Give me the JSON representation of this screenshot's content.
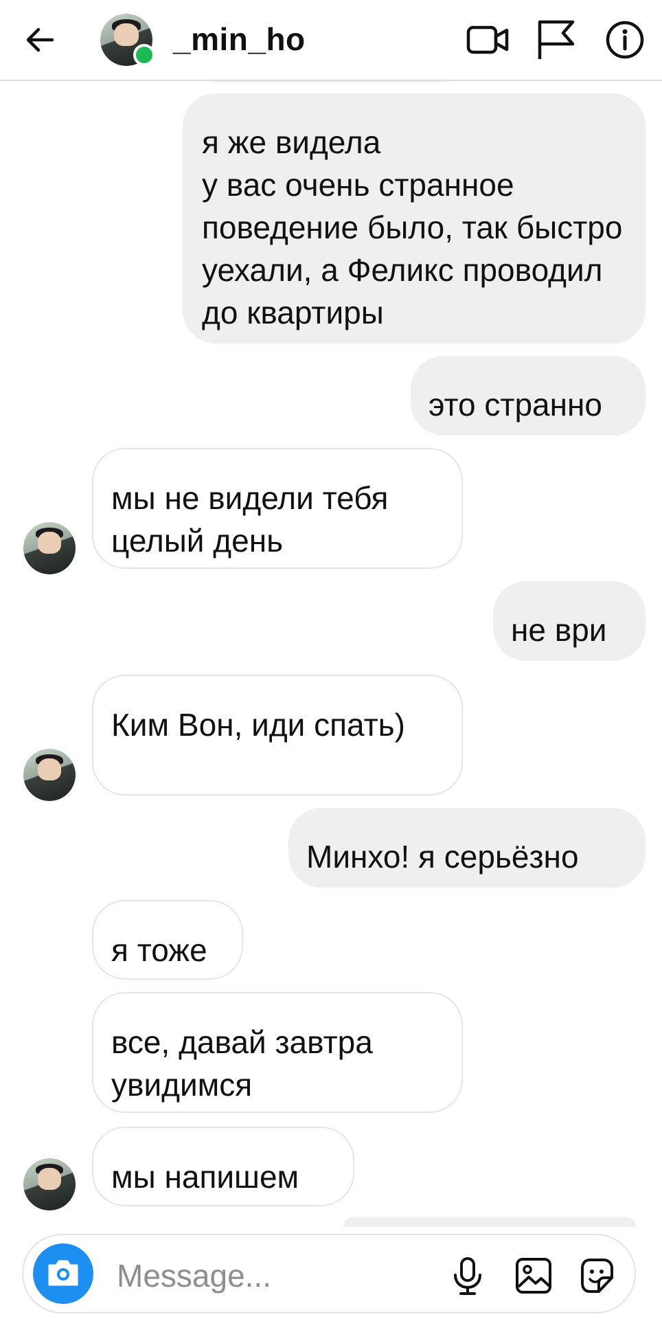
{
  "header": {
    "username": "_min_ho",
    "icons": [
      "back-arrow-icon",
      "video-camera-icon",
      "flag-icon",
      "info-icon"
    ]
  },
  "messages": [
    {
      "dir": "out",
      "text": "я же видела\nу вас очень странное поведение было, так быстро уехали, а Феликс проводил до квартиры"
    },
    {
      "dir": "out",
      "text": "это странно"
    },
    {
      "dir": "in",
      "text": "мы не видели тебя целый день"
    },
    {
      "dir": "out",
      "text": "не ври"
    },
    {
      "dir": "in",
      "text": "Ким Вон, иди спать)"
    },
    {
      "dir": "out",
      "text": "Минхо! я серьёзно"
    },
    {
      "dir": "in",
      "text": "я тоже"
    },
    {
      "dir": "in",
      "text": "все, давай завтра увидимся"
    },
    {
      "dir": "in",
      "text": "мы напишем"
    }
  ],
  "composer": {
    "placeholder": "Message...",
    "icons": [
      "camera-icon",
      "microphone-icon",
      "gallery-icon",
      "sticker-icon"
    ]
  },
  "colors": {
    "outgoing_bubble": "#efeff0",
    "incoming_border": "#e6e6e6",
    "online": "#1db954",
    "camera_button": "#1c8ff0"
  }
}
